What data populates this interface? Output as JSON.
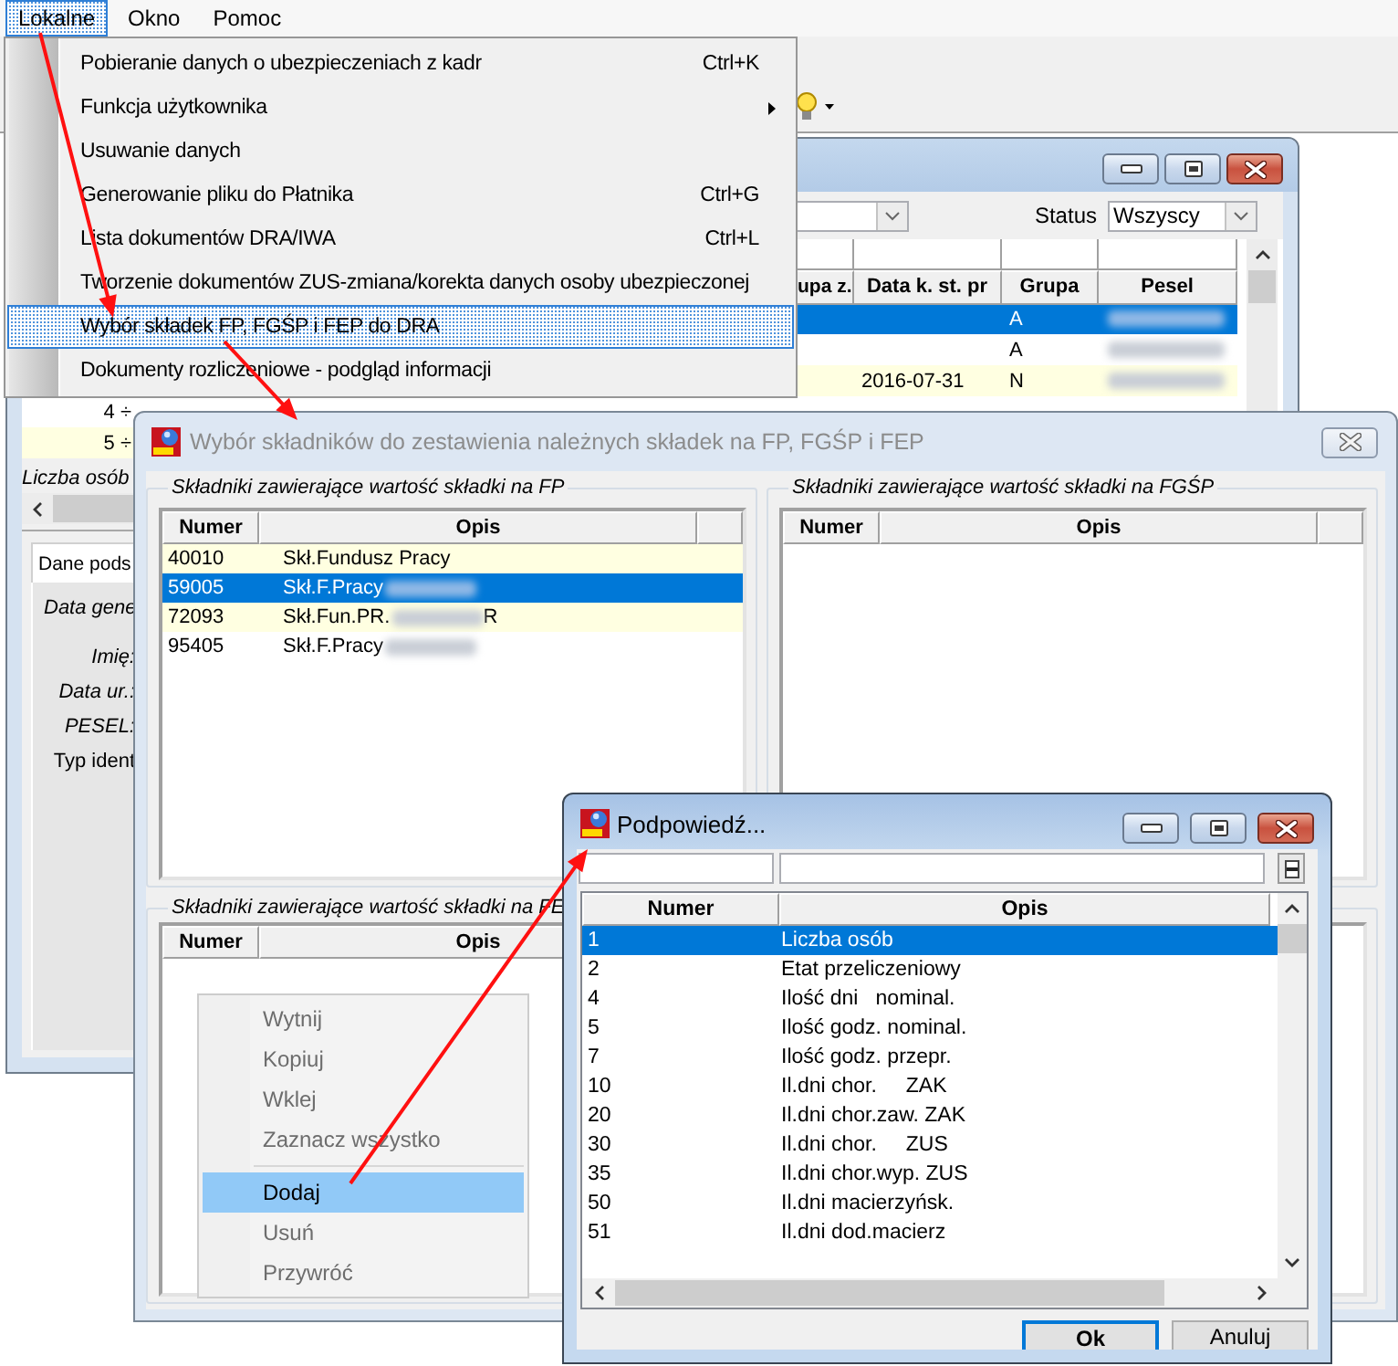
{
  "menubar": [
    {
      "label": "Lokalne",
      "selected": true
    },
    {
      "label": "Okno",
      "selected": false
    },
    {
      "label": "Pomoc",
      "selected": false
    }
  ],
  "dropdown_menu": [
    {
      "label": "Pobieranie danych o ubezpieczeniach z kadr",
      "shortcut": "Ctrl+K",
      "submenu": false,
      "selected": false
    },
    {
      "label": "Funkcja użytkownika",
      "submenu": true,
      "selected": false
    },
    {
      "label": "Usuwanie danych",
      "submenu": false,
      "selected": false
    },
    {
      "label": "Generowanie pliku do Płatnika",
      "shortcut": "Ctrl+G",
      "submenu": false,
      "selected": false
    },
    {
      "label": "Lista dokumentów DRA/IWA",
      "shortcut": "Ctrl+L",
      "submenu": false,
      "selected": false
    },
    {
      "label": "Tworzenie dokumentów ZUS-zmiana/korekta danych osoby ubezpieczonej",
      "submenu": false,
      "selected": false
    },
    {
      "label": "Wybór składek FP, FGŚP i FEP do DRA",
      "submenu": false,
      "selected": true
    },
    {
      "label": "Dokumenty rozliczeniowe - podgląd informacji",
      "submenu": false,
      "selected": false
    }
  ],
  "list_window": {
    "status_label": "Status",
    "status_value": "Wszyscy",
    "columns": [
      "upa z.",
      "Data k. st. pr",
      "Grupa",
      "Pesel"
    ],
    "rows": [
      {
        "grupa": "A",
        "pesel_redacted": true,
        "selected": true
      },
      {
        "grupa": "A",
        "pesel_redacted": true,
        "selected": false
      },
      {
        "data_k_st_pr": "2016-07-31",
        "grupa": "N",
        "pesel_redacted": true,
        "selected": false
      },
      {
        "number": "4 ÷",
        "pesel_redacted": false,
        "selected": false
      },
      {
        "number": "5 ÷",
        "pesel_redacted": false,
        "selected": false
      }
    ],
    "summary": "Liczba osób",
    "tab": {
      "label": "Dane pods",
      "selected": true
    },
    "section_label": "Data gene",
    "field_labels": [
      {
        "text": "Imię:",
        "italic": true
      },
      {
        "text": "Data ur.:",
        "italic": true
      },
      {
        "text": "PESEL:",
        "italic": true
      },
      {
        "text": "Typ ident",
        "italic": false
      }
    ]
  },
  "selection_dialog": {
    "title": "Wybór składników do zestawienia należnych składek na FP, FGŚP i FEP",
    "active": false,
    "groups": [
      {
        "title": "Składniki zawierające wartość składki na FP",
        "columns": [
          "Numer",
          "Opis"
        ],
        "rows": [
          {
            "numer": "40010",
            "opis": "Skł.Fundusz Pracy",
            "redacted": false,
            "selected": false
          },
          {
            "numer": "59005",
            "opis": "Skł.F.Pracy",
            "redacted": true,
            "selected": true
          },
          {
            "numer": "72093",
            "opis": "Skł.Fun.PR.",
            "redacted": true,
            "opis_end": "R",
            "selected": false
          },
          {
            "numer": "95405",
            "opis": "Skł.F.Pracy",
            "redacted": true,
            "selected": false
          }
        ]
      },
      {
        "title": "Składniki zawierające wartość składki na FGŚP",
        "columns": [
          "Numer",
          "Opis"
        ]
      },
      {
        "title": "Składniki zawierające wartość składki na FE",
        "columns": [
          "Numer",
          "Opis"
        ]
      }
    ]
  },
  "context_menu": [
    {
      "kind": "item",
      "label": "Wytnij",
      "disabled": true,
      "selected": false
    },
    {
      "kind": "item",
      "label": "Kopiuj",
      "disabled": true,
      "selected": false
    },
    {
      "kind": "item",
      "label": "Wklej",
      "disabled": true,
      "selected": false
    },
    {
      "kind": "item",
      "label": "Zaznacz wszystko",
      "disabled": true,
      "selected": false
    },
    {
      "kind": "separator"
    },
    {
      "kind": "item",
      "label": "Dodaj",
      "disabled": false,
      "selected": true
    },
    {
      "kind": "item",
      "label": "Usuń",
      "disabled": true,
      "selected": false
    },
    {
      "kind": "item",
      "label": "Przywróć",
      "disabled": true,
      "selected": false
    }
  ],
  "hint_window": {
    "title": "Podpowiedź...",
    "active": true,
    "columns": [
      "Numer",
      "Opis"
    ],
    "rows": [
      {
        "numer": "1",
        "opis": "Liczba osób",
        "selected": true
      },
      {
        "numer": "2",
        "opis": "Etat przeliczeniowy",
        "selected": false
      },
      {
        "numer": "4",
        "opis": "Ilość dni   nominal.",
        "selected": false
      },
      {
        "numer": "5",
        "opis": "Ilość godz. nominal.",
        "selected": false
      },
      {
        "numer": "7",
        "opis": "Ilość godz. przepr.",
        "selected": false
      },
      {
        "numer": "10",
        "opis": "Il.dni chor.     ZAK",
        "selected": false
      },
      {
        "numer": "20",
        "opis": "Il.dni chor.zaw. ZAK",
        "selected": false
      },
      {
        "numer": "30",
        "opis": "Il.dni chor.     ZUS",
        "selected": false
      },
      {
        "numer": "35",
        "opis": "Il.dni chor.wyp. ZUS",
        "selected": false
      },
      {
        "numer": "50",
        "opis": "Il.dni macierzyńsk.",
        "selected": false
      },
      {
        "numer": "51",
        "opis": "Il.dni dod.macierz",
        "selected": false
      }
    ],
    "buttons": [
      {
        "label": "Ok",
        "default": true
      },
      {
        "label": "Anuluj",
        "default": false
      }
    ]
  }
}
